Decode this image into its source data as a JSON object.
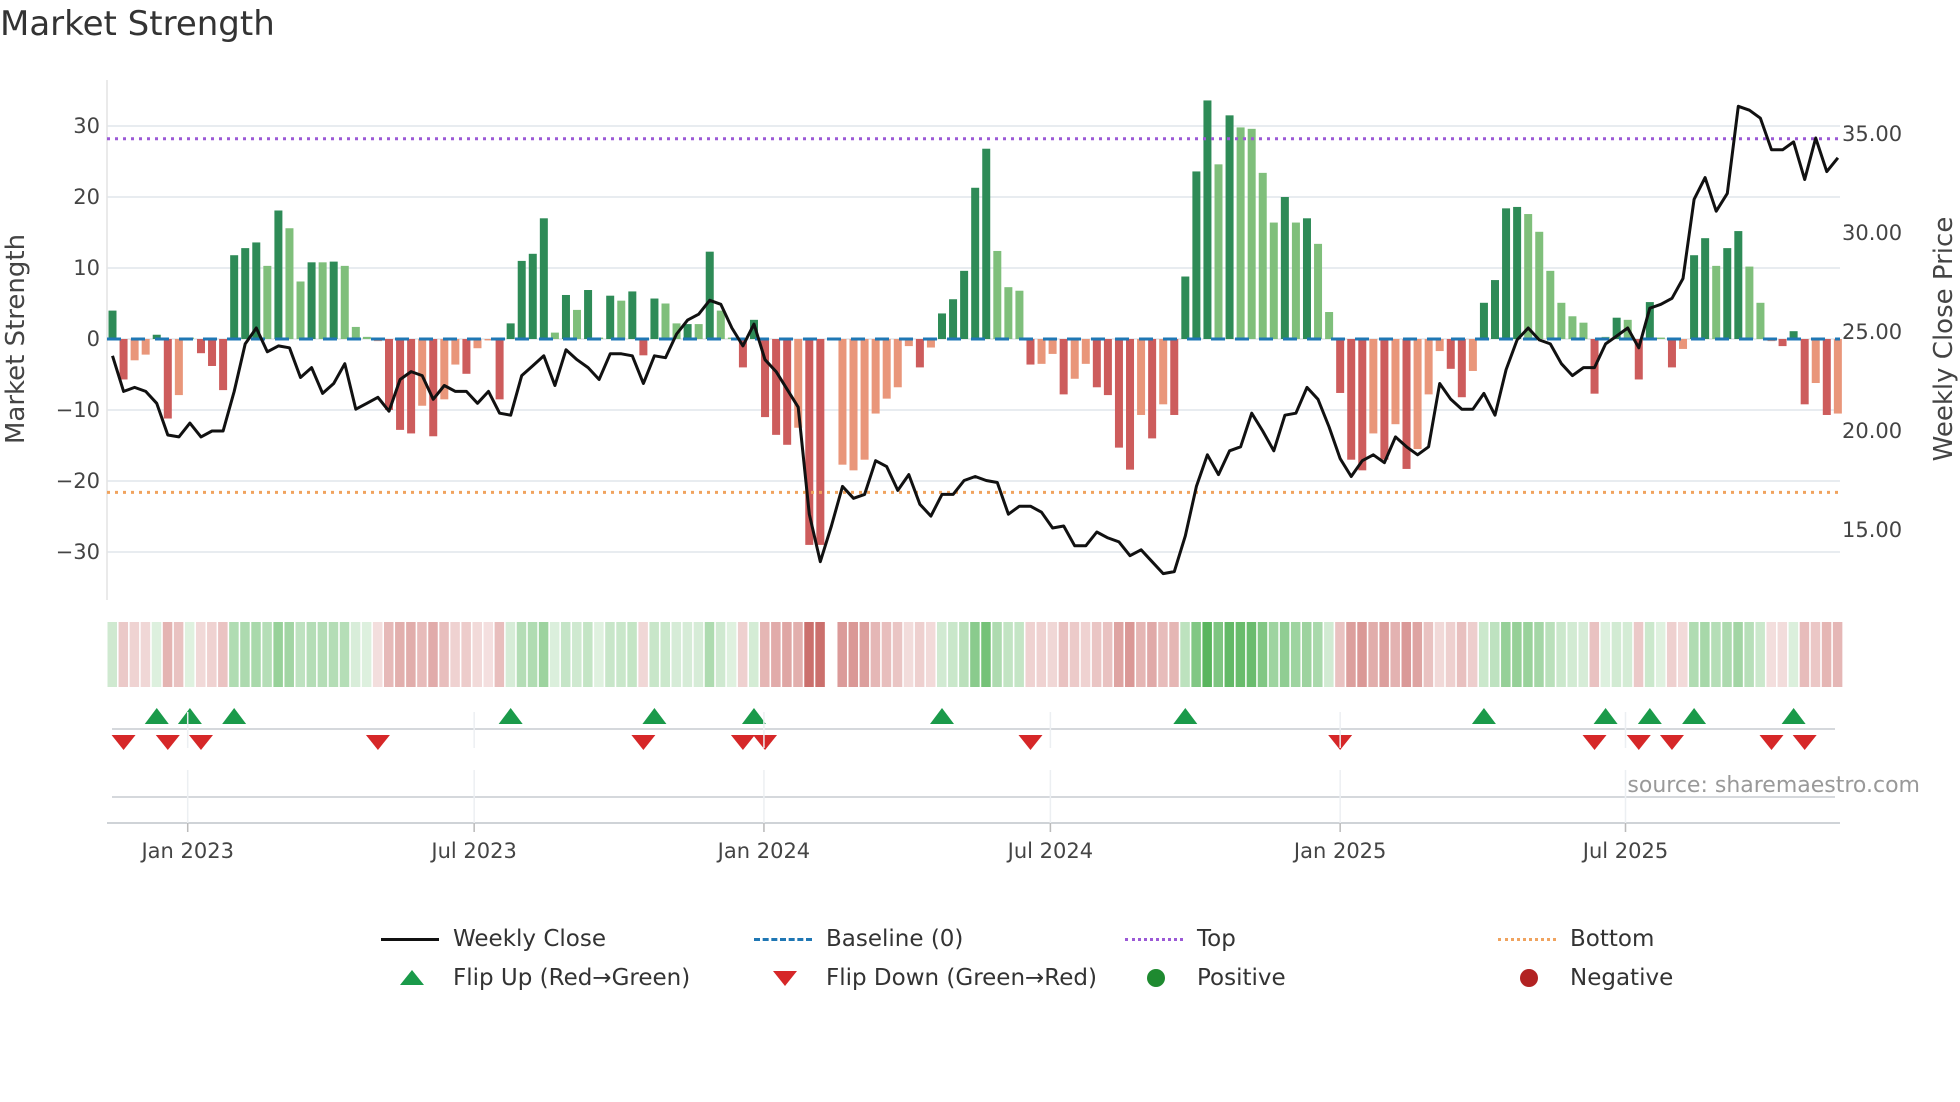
{
  "chart_data": {
    "type": "bar",
    "title": "Market Strength",
    "ylabel": "Market Strength",
    "y2label": "Weekly Close Price",
    "ylim": [
      -36,
      37
    ],
    "y2lim": [
      12,
      38
    ],
    "yticks": [
      -30,
      -20,
      -10,
      0,
      10,
      20,
      30
    ],
    "y2ticks": [
      "15.00",
      "20.00",
      "25.00",
      "30.00",
      "35.00"
    ],
    "top_level": 28.2,
    "bottom_level": -21.6,
    "xticks": [
      {
        "label": "Jan 2023",
        "week": 6.8
      },
      {
        "label": "Jul 2023",
        "week": 32.7
      },
      {
        "label": "Jan 2024",
        "week": 58.9
      },
      {
        "label": "Jul 2024",
        "week": 84.8
      },
      {
        "label": "Jan 2025",
        "week": 111.0
      },
      {
        "label": "Jul 2025",
        "week": 136.8
      }
    ],
    "strength": [
      4.0,
      -5.7,
      -3.0,
      -2.2,
      0.6,
      -11.2,
      -7.9,
      0.2,
      -2.0,
      -3.8,
      -7.2,
      11.8,
      12.8,
      13.6,
      10.3,
      18.1,
      15.6,
      8.1,
      10.8,
      10.8,
      10.9,
      10.3,
      1.7,
      0.3,
      -0.3,
      -10.0,
      -12.8,
      -13.3,
      -9.4,
      -13.7,
      -8.5,
      -3.6,
      -4.9,
      -1.3,
      -0.2,
      -8.5,
      2.2,
      11.0,
      12.0,
      17.0,
      0.9,
      6.2,
      4.1,
      6.9,
      0.2,
      6.1,
      5.4,
      6.7,
      -2.3,
      5.7,
      5.0,
      2.2,
      2.1,
      2.1,
      12.3,
      4.0,
      0.2,
      -4.0,
      2.7,
      -11.0,
      -13.5,
      -14.9,
      -12.5,
      -29.0,
      -29.0,
      null,
      -17.7,
      -18.5,
      -17.0,
      -10.5,
      -8.4,
      -6.8,
      -1.0,
      -4.0,
      -1.2,
      3.6,
      5.6,
      9.6,
      21.3,
      26.8,
      12.4,
      7.3,
      6.8,
      -3.6,
      -3.5,
      -2.1,
      -7.8,
      -5.6,
      -3.5,
      -6.8,
      -7.9,
      -15.3,
      -18.4,
      -10.7,
      -14.0,
      -9.2,
      -10.7,
      8.8,
      23.6,
      33.6,
      24.6,
      31.5,
      29.8,
      29.6,
      23.4,
      16.4,
      20.0,
      16.4,
      17.0,
      13.4,
      3.8,
      -7.6,
      -17.0,
      -18.5,
      -13.3,
      -17.0,
      -12.0,
      -18.3,
      -15.5,
      -7.8,
      -1.7,
      -4.2,
      -8.2,
      -4.5,
      5.1,
      8.3,
      18.4,
      18.6,
      17.6,
      15.1,
      9.6,
      5.1,
      3.2,
      2.3,
      -7.7,
      0.3,
      3.0,
      2.7,
      -5.7,
      5.2,
      0.2,
      -4.0,
      -1.4,
      11.8,
      14.2,
      10.3,
      12.8,
      15.2,
      10.2,
      5.1,
      -0.3,
      -1.0,
      1.1,
      -9.2,
      -6.2,
      -10.7,
      -10.5
    ],
    "shade": [
      "dg",
      "r",
      "s",
      "s",
      "dg",
      "r",
      "s",
      "lg",
      "r",
      "r",
      "r",
      "dg",
      "dg",
      "dg",
      "lg",
      "dg",
      "lg",
      "lg",
      "dg",
      "lg",
      "dg",
      "lg",
      "lg",
      "lg",
      "s",
      "r",
      "r",
      "r",
      "s",
      "r",
      "s",
      "s",
      "r",
      "s",
      "s",
      "r",
      "dg",
      "dg",
      "dg",
      "dg",
      "lg",
      "dg",
      "lg",
      "dg",
      "lg",
      "dg",
      "lg",
      "dg",
      "r",
      "dg",
      "lg",
      "lg",
      "dg",
      "lg",
      "dg",
      "lg",
      "lg",
      "r",
      "dg",
      "r",
      "r",
      "r",
      "s",
      "r",
      "r",
      "none",
      "s",
      "s",
      "s",
      "s",
      "s",
      "s",
      "s",
      "r",
      "s",
      "dg",
      "dg",
      "dg",
      "dg",
      "dg",
      "lg",
      "lg",
      "lg",
      "r",
      "s",
      "s",
      "r",
      "s",
      "s",
      "r",
      "r",
      "r",
      "r",
      "s",
      "r",
      "s",
      "r",
      "dg",
      "dg",
      "dg",
      "lg",
      "dg",
      "lg",
      "lg",
      "lg",
      "lg",
      "dg",
      "lg",
      "dg",
      "lg",
      "lg",
      "r",
      "r",
      "r",
      "s",
      "r",
      "s",
      "r",
      "s",
      "s",
      "s",
      "r",
      "r",
      "s",
      "dg",
      "dg",
      "dg",
      "dg",
      "lg",
      "lg",
      "lg",
      "lg",
      "lg",
      "lg",
      "r",
      "lg",
      "dg",
      "lg",
      "r",
      "dg",
      "lg",
      "r",
      "s",
      "dg",
      "dg",
      "lg",
      "dg",
      "dg",
      "lg",
      "lg",
      "s",
      "r",
      "dg",
      "r",
      "s",
      "r",
      "s"
    ],
    "close": [
      23.8,
      22.0,
      22.2,
      22.0,
      21.4,
      19.8,
      19.7,
      20.4,
      19.7,
      20.0,
      20.0,
      22.0,
      24.4,
      25.2,
      24.0,
      24.3,
      24.2,
      22.7,
      23.2,
      21.9,
      22.4,
      23.4,
      21.1,
      21.4,
      21.7,
      21.0,
      22.6,
      23.0,
      22.8,
      21.6,
      22.3,
      22.0,
      22.0,
      21.4,
      22.0,
      20.9,
      20.8,
      22.8,
      23.3,
      23.8,
      22.3,
      24.1,
      23.6,
      23.2,
      22.6,
      23.9,
      23.9,
      23.8,
      22.4,
      23.8,
      23.7,
      24.9,
      25.6,
      25.9,
      26.6,
      26.4,
      25.2,
      24.3,
      25.4,
      23.6,
      23.0,
      22.1,
      21.2,
      15.8,
      13.4,
      15.2,
      17.2,
      16.6,
      16.8,
      18.5,
      18.2,
      17.0,
      17.8,
      16.3,
      15.7,
      16.8,
      16.8,
      17.5,
      17.7,
      17.5,
      17.4,
      15.8,
      16.2,
      16.2,
      15.9,
      15.1,
      15.2,
      14.2,
      14.2,
      14.9,
      14.6,
      14.4,
      13.7,
      14.0,
      13.4,
      12.8,
      12.9,
      14.7,
      17.2,
      18.8,
      17.8,
      19.0,
      19.2,
      20.9,
      20.0,
      19.0,
      20.8,
      20.9,
      22.2,
      21.6,
      20.2,
      18.6,
      17.7,
      18.5,
      18.8,
      18.4,
      19.7,
      19.2,
      18.8,
      19.2,
      22.4,
      21.6,
      21.1,
      21.1,
      21.9,
      20.8,
      23.1,
      24.6,
      25.2,
      24.6,
      24.4,
      23.4,
      22.8,
      23.2,
      23.2,
      24.4,
      24.8,
      25.2,
      24.2,
      26.2,
      26.4,
      26.7,
      27.7,
      31.7,
      32.8,
      31.1,
      32.0,
      36.4,
      36.2,
      35.8,
      34.2,
      34.2,
      34.6,
      32.7,
      34.8,
      33.1,
      33.8
    ],
    "legend": {
      "weekly_close": "Weekly Close",
      "baseline": "Baseline (0)",
      "top": "Top",
      "bottom": "Bottom",
      "flip_up": "Flip Up (Red→Green)",
      "flip_down": "Flip Down (Green→Red)",
      "positive": "Positive",
      "negative": "Negative"
    },
    "legend_placement": "bottom",
    "source": "source: sharemaestro.com",
    "colors": {
      "dg": "#2e8b57",
      "lg": "#7fbf7b",
      "r": "#cd5c5c",
      "s": "#e9967a",
      "line": "#111111",
      "baseline": "#1f77b4",
      "top": "#9b59d6",
      "bottom": "#f0a35e",
      "up": "#1a9a4a",
      "down": "#d62728",
      "pos": "#1e8a30",
      "neg": "#b22222",
      "heat_pos": "#4caf50",
      "heat_neg": "#c0504d",
      "grid": "#e8ecf0"
    }
  }
}
